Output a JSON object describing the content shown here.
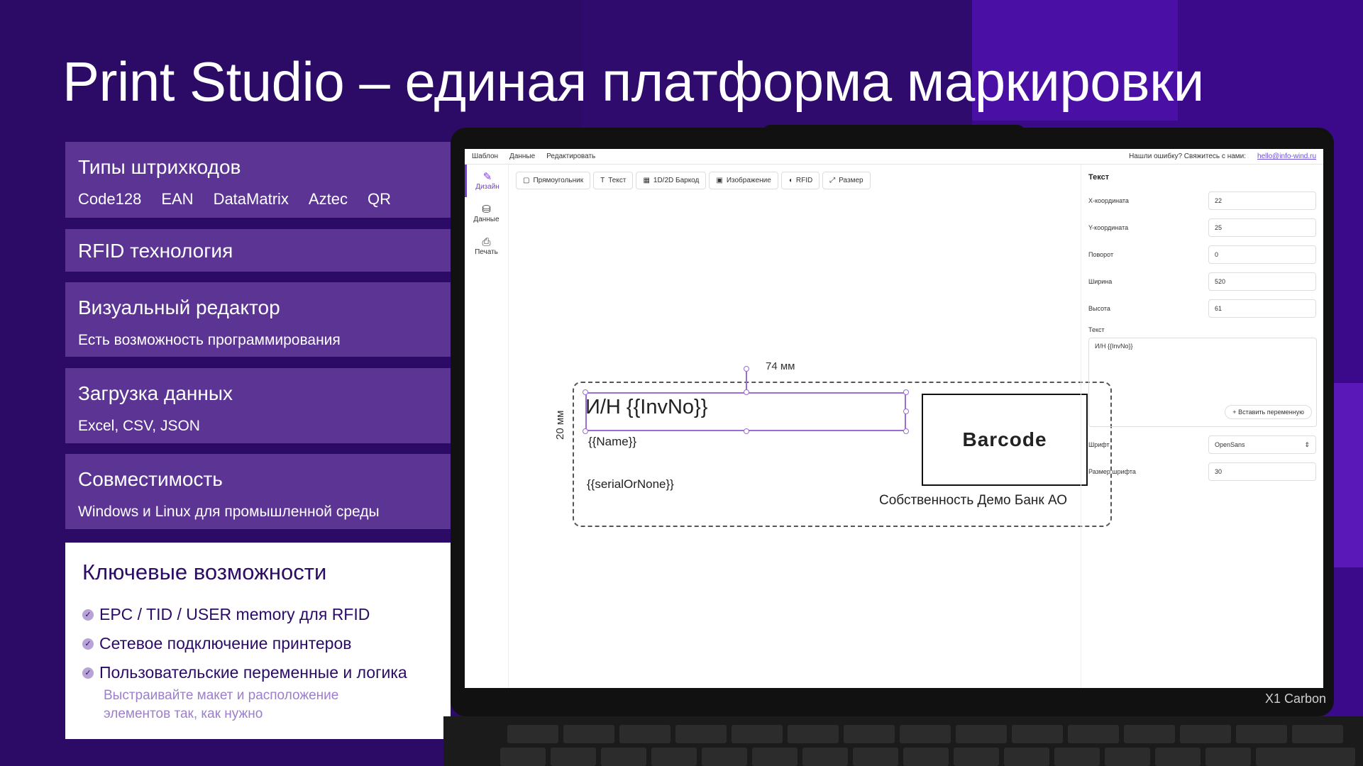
{
  "slide": {
    "title": "Print Studio – единая платформа маркировки"
  },
  "cards": [
    {
      "title": "Типы штрихкодов",
      "items": [
        "Code128",
        "EAN",
        "DataMatrix",
        "Aztec",
        "QR"
      ]
    },
    {
      "title": "RFID технология"
    },
    {
      "title": "Визуальный редактор",
      "sub": "Есть возможность программирования"
    },
    {
      "title": "Загрузка данных",
      "sub": "Excel, CSV, JSON"
    },
    {
      "title": "Совместимость",
      "sub": "Windows и Linux для промышленной среды"
    }
  ],
  "features": {
    "title": "Ключевые возможности",
    "items": [
      "EPC / TID / USER memory для RFID",
      "Сетевое подключение принтеров",
      "Пользовательские переменные и логика"
    ],
    "note_line1": "Выстраивайте макет и расположение",
    "note_line2": "элементов так, как нужно"
  },
  "laptop": {
    "model": "X1 Carbon"
  },
  "app": {
    "menu": [
      "Шаблон",
      "Данные",
      "Редактировать"
    ],
    "feedback_text": "Нашли ошибку? Свяжитесь с нами:",
    "feedback_email": "hello@info-wind.ru",
    "rail": [
      {
        "label": "Дизайн",
        "icon": "✎"
      },
      {
        "label": "Данные",
        "icon": "⛁"
      },
      {
        "label": "Печать",
        "icon": "⎙"
      }
    ],
    "toolbar": [
      {
        "label": "Прямоугольник",
        "icon": "▢"
      },
      {
        "label": "Текст",
        "icon": "T"
      },
      {
        "label": "1D/2D Баркод",
        "icon": "▦"
      },
      {
        "label": "Изображение",
        "icon": "▣"
      },
      {
        "label": "RFID",
        "icon": "◖"
      },
      {
        "label": "Размер",
        "icon": "⤢"
      }
    ],
    "canvas": {
      "width_label": "74 мм",
      "height_label": "20 мм",
      "field_invno": "И/Н {{InvNo}}",
      "field_name": "{{Name}}",
      "field_serial": "{{serialOrNone}}",
      "barcode_text": "Barcode",
      "owner_text": "Собственность Демо Банк АО"
    },
    "props": {
      "title": "Текст",
      "rows": [
        {
          "label": "X-координата",
          "value": "22"
        },
        {
          "label": "Y-координата",
          "value": "25"
        },
        {
          "label": "Поворот",
          "value": "0"
        },
        {
          "label": "Ширина",
          "value": "520"
        },
        {
          "label": "Высота",
          "value": "61"
        }
      ],
      "text_label": "Текст",
      "text_value": "И/Н {{InvNo}}",
      "insert_button": "Вставить переменную",
      "font_label": "Шрифт",
      "font_value": "OpenSans",
      "font_size_label": "Размер шрифта",
      "font_size_value": "30"
    }
  }
}
